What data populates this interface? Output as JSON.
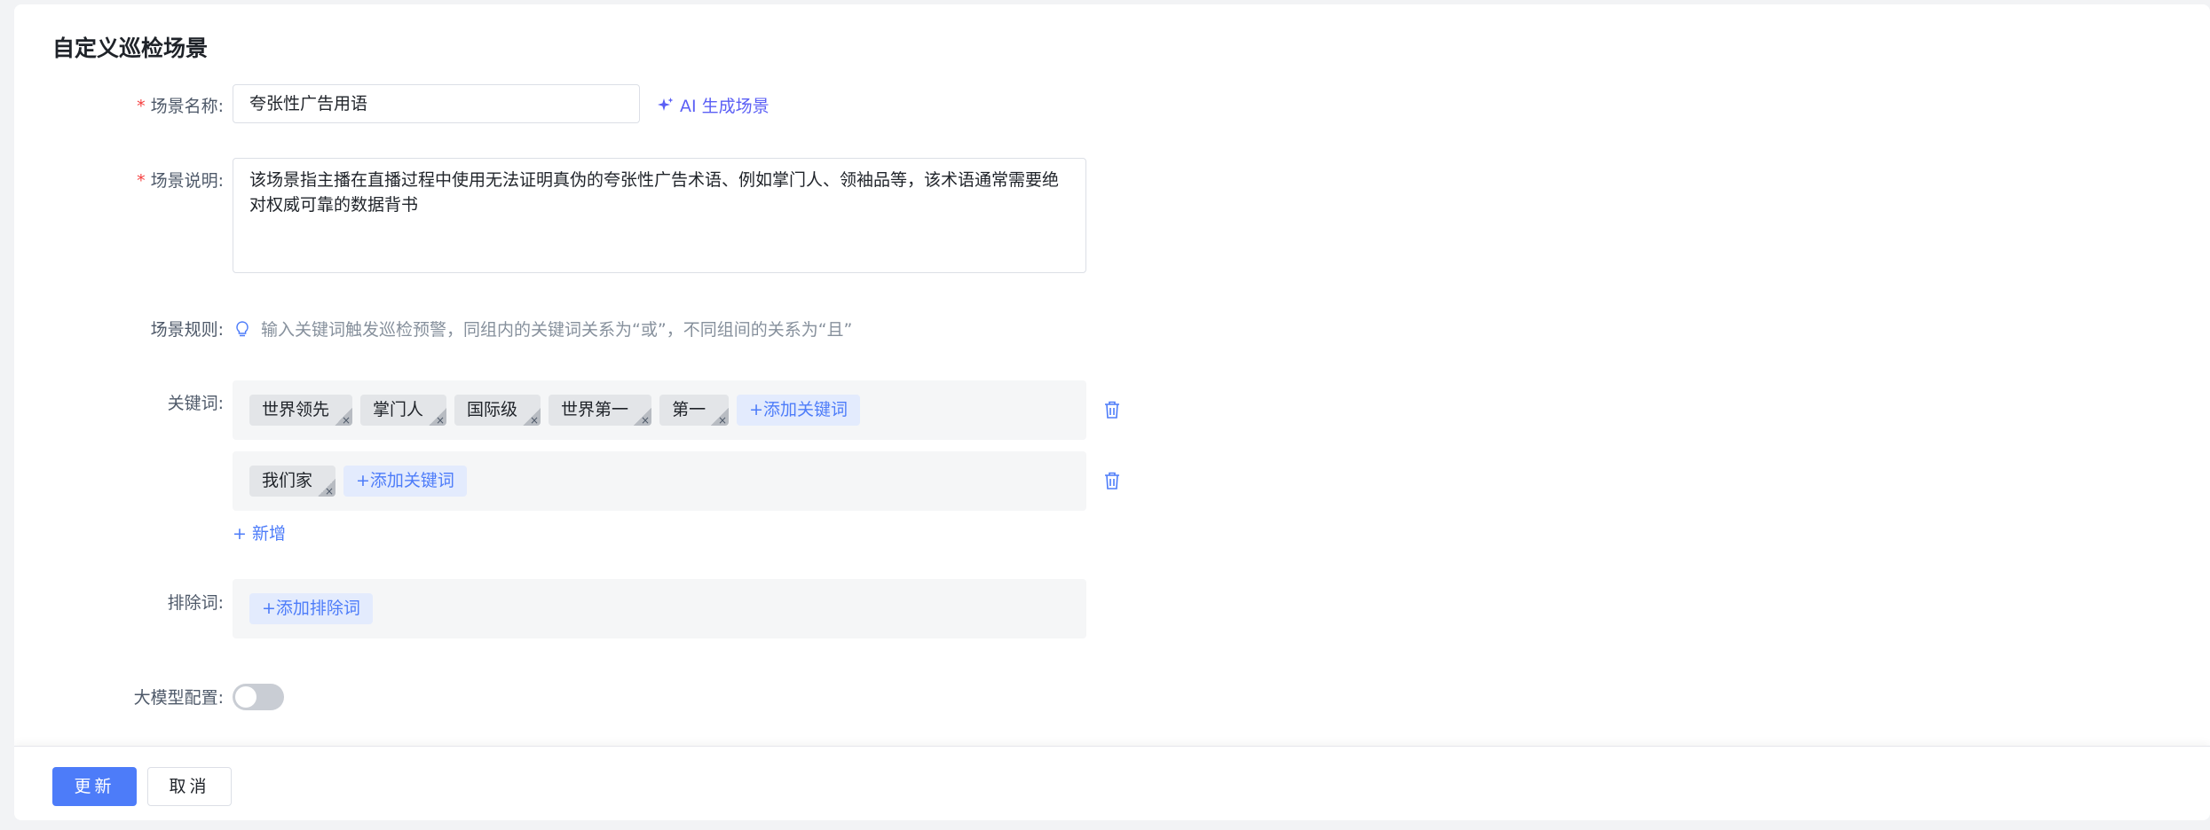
{
  "page": {
    "title": "自定义巡检场景"
  },
  "form": {
    "name_label": "场景名称:",
    "name_value": "夸张性广告用语",
    "ai_button": "AI 生成场景",
    "desc_label": "场景说明:",
    "desc_value": "该场景指主播在直播过程中使用无法证明真伪的夸张性广告术语、例如掌门人、领袖品等，该术语通常需要绝对权威可靠的数据背书",
    "rule_label": "场景规则:",
    "rule_hint": "输入关键词触发巡检预警，同组内的关键词关系为“或”，不同组间的关系为“且”",
    "keywords_label": "关键词:",
    "keyword_groups": [
      {
        "tags": [
          "世界领先",
          "掌门人",
          "国际级",
          "世界第一",
          "第一"
        ],
        "add_label": "+添加关键词"
      },
      {
        "tags": [
          "我们家"
        ],
        "add_label": "+添加关键词"
      }
    ],
    "new_group_label": "+ 新增",
    "exclude_label": "排除词:",
    "exclude_add_label": "+添加排除词",
    "llm_label": "大模型配置:",
    "llm_enabled": false,
    "required_mark": "*"
  },
  "footer": {
    "update_label": "更新",
    "cancel_label": "取消"
  },
  "colors": {
    "primary": "#4d7cf9",
    "ai_purple": "#5b5ff5",
    "required": "#f53f3f",
    "tag_bg": "#e3e5e8",
    "group_bg": "#f5f6f7"
  }
}
